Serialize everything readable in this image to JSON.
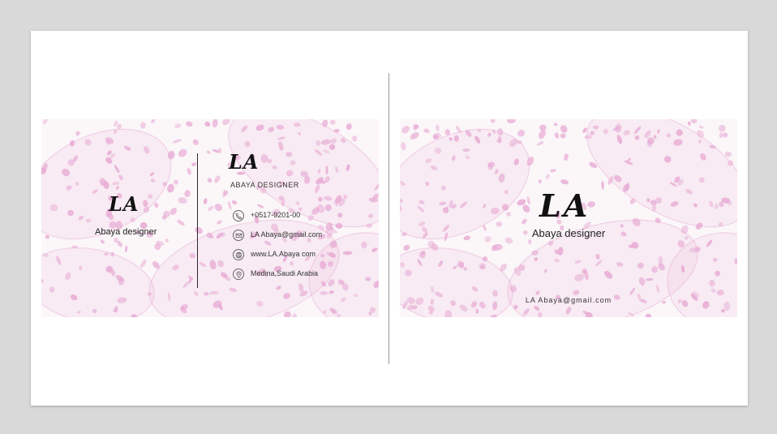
{
  "front": {
    "logo_left": "LA",
    "tagline_left": "Abaya designer",
    "logo_right": "LA",
    "role": "ABAYA DESIGNER",
    "contacts": [
      {
        "icon": "phone-icon",
        "text": "+0517-9201-00"
      },
      {
        "icon": "email-icon",
        "text": "LA Abaya@gmail.com"
      },
      {
        "icon": "globe-icon",
        "text": "www.LA.Abaya com"
      },
      {
        "icon": "location-pin-icon",
        "text": "Medina,Saudi Arabia"
      }
    ]
  },
  "back": {
    "logo": "LA",
    "tagline": "Abaya designer",
    "email": "LA Abaya@gmail.com"
  },
  "colors": {
    "pattern_pink": "#e7a9d4",
    "card_background": "#fbf6f8",
    "page_background": "#ffffff",
    "canvas_background": "#d9d9d9"
  }
}
